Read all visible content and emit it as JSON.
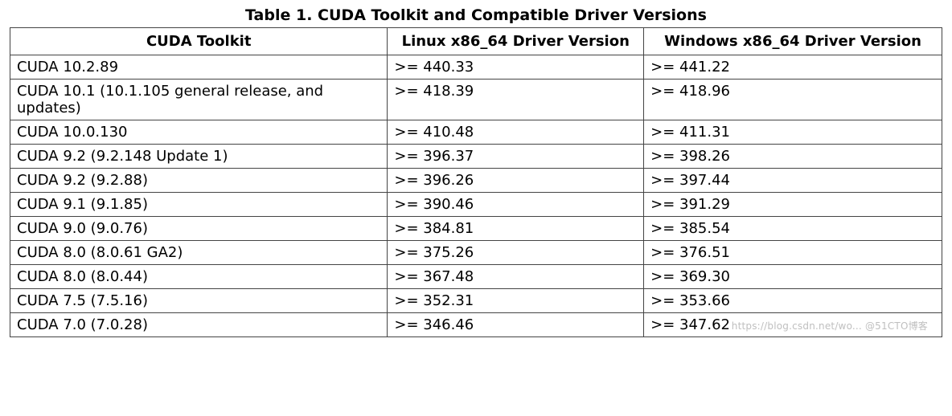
{
  "title": "Table 1. CUDA Toolkit and Compatible Driver Versions",
  "headers": {
    "c1": "CUDA Toolkit",
    "c2": "Linux x86_64 Driver Version",
    "c3": "Windows x86_64 Driver Version"
  },
  "rows": [
    {
      "toolkit": "CUDA 10.2.89",
      "linux": ">= 440.33",
      "windows": ">= 441.22"
    },
    {
      "toolkit": "CUDA 10.1 (10.1.105 general release, and updates)",
      "linux": ">= 418.39",
      "windows": ">= 418.96"
    },
    {
      "toolkit": "CUDA 10.0.130",
      "linux": ">= 410.48",
      "windows": ">= 411.31"
    },
    {
      "toolkit": "CUDA 9.2 (9.2.148 Update 1)",
      "linux": ">= 396.37",
      "windows": ">= 398.26"
    },
    {
      "toolkit": "CUDA 9.2 (9.2.88)",
      "linux": ">= 396.26",
      "windows": ">= 397.44"
    },
    {
      "toolkit": "CUDA 9.1 (9.1.85)",
      "linux": ">= 390.46",
      "windows": ">= 391.29"
    },
    {
      "toolkit": "CUDA 9.0 (9.0.76)",
      "linux": ">= 384.81",
      "windows": ">= 385.54"
    },
    {
      "toolkit": "CUDA 8.0 (8.0.61 GA2)",
      "linux": ">= 375.26",
      "windows": ">= 376.51"
    },
    {
      "toolkit": "CUDA 8.0 (8.0.44)",
      "linux": ">= 367.48",
      "windows": ">= 369.30"
    },
    {
      "toolkit": "CUDA 7.5 (7.5.16)",
      "linux": ">= 352.31",
      "windows": ">= 353.66"
    },
    {
      "toolkit": "CUDA 7.0 (7.0.28)",
      "linux": ">= 346.46",
      "windows": ">= 347.62"
    }
  ],
  "watermark": "https://blog.csdn.net/wo... @51CTO博客"
}
